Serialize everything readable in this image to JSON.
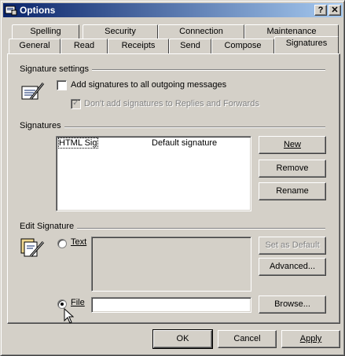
{
  "window": {
    "title": "Options",
    "help_btn": "?",
    "close_btn": "✕"
  },
  "tabs_back": [
    "Spelling",
    "Security",
    "Connection",
    "Maintenance"
  ],
  "tabs_front": [
    "General",
    "Read",
    "Receipts",
    "Send",
    "Compose",
    "Signatures"
  ],
  "active_tab": "Signatures",
  "signature_settings": {
    "group_label": "Signature settings",
    "add_all_label": "Add signatures to all outgoing messages",
    "dont_add_replies_label": "Don't add signatures to Replies and Forwards"
  },
  "signatures": {
    "group_label": "Signatures",
    "list": [
      {
        "name": "HTML Sig",
        "status": "Default signature"
      }
    ],
    "new_button": "New",
    "remove_button": "Remove",
    "rename_button": "Rename"
  },
  "edit_signature": {
    "group_label": "Edit Signature",
    "text_radio": "Text",
    "file_radio": "File",
    "set_default_button": "Set as Default",
    "advanced_button": "Advanced...",
    "browse_button": "Browse...",
    "file_value": ""
  },
  "footer": {
    "ok": "OK",
    "cancel": "Cancel",
    "apply": "Apply"
  }
}
